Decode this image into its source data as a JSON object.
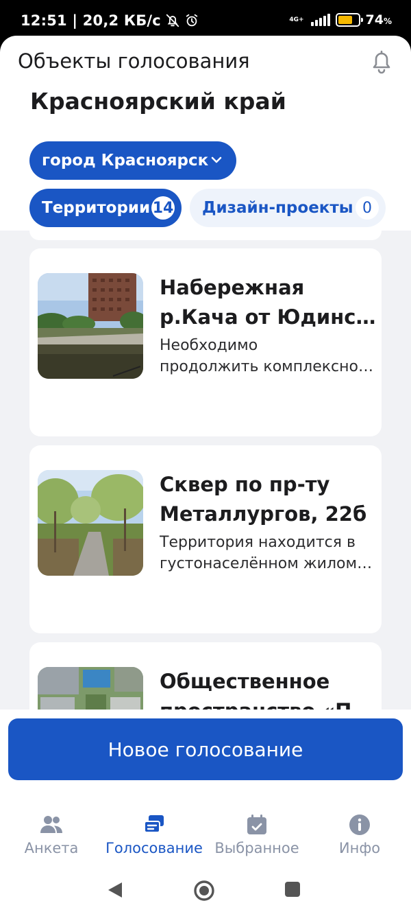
{
  "status_bar": {
    "left_text": "12:51 | 20,2 КБ/с",
    "network_type": "4G+",
    "battery_percent": "74",
    "battery_unit": "%",
    "battery_level": 0.74,
    "icons": [
      "bell-off-icon",
      "alarm-icon",
      "signal-icon",
      "battery-icon"
    ]
  },
  "header": {
    "title": "Объекты голосования",
    "notifications_icon": "bell-icon"
  },
  "region": "Красноярский край",
  "city_select": {
    "value": "город Красноярск",
    "icon": "chevron-down-icon"
  },
  "tabs": [
    {
      "label": "Территории",
      "count": "14",
      "active": true
    },
    {
      "label": "Дизайн-проекты",
      "count": "0",
      "active": false
    }
  ],
  "items": [
    {
      "title_line1": "Набережная",
      "title_line2": "р.Кача от Юдинского моста",
      "desc_line1": "Необходимо",
      "desc_line2": "продолжить комплексное благоустройство"
    },
    {
      "title_line1": "Сквер по пр-ту",
      "title_line2": "Металлургов, 22б",
      "desc_line1": "Территория находится в",
      "desc_line2": "густонаселённом жилом районе"
    },
    {
      "title_line1": "Общественное",
      "title_line2": "пространство «П",
      "desc_line1": "",
      "desc_line2": ""
    }
  ],
  "primary_action": "Новое голосование",
  "bottom_nav": [
    {
      "label": "Анкета",
      "icon": "people-icon",
      "active": false
    },
    {
      "label": "Голосование",
      "icon": "ballot-icon",
      "active": true
    },
    {
      "label": "Выбранное",
      "icon": "calendar-check-icon",
      "active": false
    },
    {
      "label": "Инфо",
      "icon": "info-icon",
      "active": false
    }
  ],
  "colors": {
    "accent": "#1a56c4",
    "tab_inactive_bg": "#eef3fb",
    "list_bg": "#f1f2f5",
    "nav_inactive": "#8a93a6"
  }
}
